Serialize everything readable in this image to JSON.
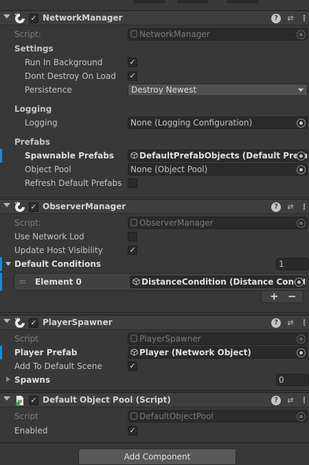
{
  "components": {
    "network_manager": {
      "title": "NetworkManager",
      "script_label": "Script:",
      "script_value": "NetworkManager",
      "settings_heading": "Settings",
      "run_in_background_label": "Run In Background",
      "run_in_background": true,
      "dont_destroy_label": "Dont Destroy On Load",
      "dont_destroy": true,
      "persistence_label": "Persistence",
      "persistence_value": "Destroy Newest",
      "logging_heading": "Logging",
      "logging_label": "Logging",
      "logging_value": "None (Logging Configuration)",
      "prefabs_heading": "Prefabs",
      "spawnable_label": "Spawnable Prefabs",
      "spawnable_value": "DefaultPrefabObjects (Default Prefab Objects)",
      "object_pool_label": "Object Pool",
      "object_pool_value": "None (Object Pool)",
      "refresh_label": "Refresh Default Prefabs",
      "refresh": false
    },
    "observer_manager": {
      "title": "ObserverManager",
      "script_label": "Script:",
      "script_value": "ObserverManager",
      "use_network_lod_label": "Use Network Lod",
      "use_network_lod": false,
      "update_host_label": "Update Host Visibility",
      "update_host": true,
      "default_conditions_label": "Default Conditions",
      "default_conditions_count": "1",
      "element0_label": "Element 0",
      "element0_value": "DistanceCondition (Distance Condition)",
      "add_label": "+",
      "remove_label": "−"
    },
    "player_spawner": {
      "title": "PlayerSpawner",
      "script_label": "Script",
      "script_value": "PlayerSpawner",
      "player_prefab_label": "Player Prefab",
      "player_prefab_value": "Player (Network Object)",
      "add_to_default_label": "Add To Default Scene",
      "add_to_default": true,
      "spawns_label": "Spawns",
      "spawns_count": "0"
    },
    "object_pool": {
      "title": "Default Object Pool (Script)",
      "script_label": "Script",
      "script_value": "DefaultObjectPool",
      "enabled_label": "Enabled",
      "enabled": true
    }
  },
  "icons": {
    "check": "✓",
    "help": "?",
    "preset": "⇄",
    "menu": "⋮"
  },
  "add_component_label": "Add Component",
  "colors": {
    "background": "#383838",
    "header": "#3e3e3e",
    "field": "#2a2a2a",
    "modified_bar": "#1d8ad6"
  }
}
